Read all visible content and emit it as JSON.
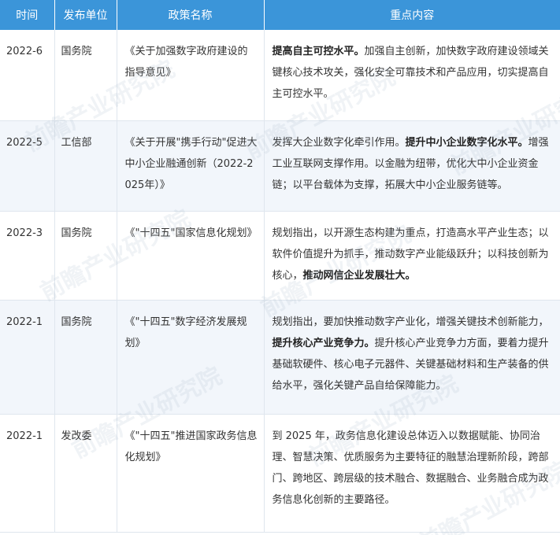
{
  "headers": [
    "时间",
    "发布单位",
    "政策名称",
    "重点内容"
  ],
  "rows": [
    {
      "time": "2022-6",
      "org": "国务院",
      "name": "《关于加强数字政府建设的指导意见》",
      "content": [
        {
          "bold": true,
          "text": "提高自主可控水平。"
        },
        {
          "bold": false,
          "text": "加强自主创新，加快数字政府建设领域关键核心技术攻关，强化安全可靠技术和产品应用，切实提高自主可控水平。"
        }
      ]
    },
    {
      "time": "2022-5",
      "org": "工信部",
      "name": "《关于开展\"携手行动\"促进大中小企业融通创新（2022-2025年）》",
      "content": [
        {
          "bold": false,
          "text": "发挥大企业数字化牵引作用。"
        },
        {
          "bold": true,
          "text": "提升中小企业数字化水平。"
        },
        {
          "bold": false,
          "text": "增强工业互联网支撑作用。以金融为纽带，优化大中小企业资金链；以平台载体为支撑，拓展大中小企业服务链等。"
        }
      ]
    },
    {
      "time": "2022-3",
      "org": "国务院",
      "name": "《\"十四五\"国家信息化规划》",
      "content": [
        {
          "bold": false,
          "text": "规划指出，以开源生态构建为重点，打造高水平产业生态；以软件价值提升为抓手，推动数字产业能级跃升；以科技创新为核心，"
        },
        {
          "bold": true,
          "text": "推动网信企业发展壮大。"
        }
      ]
    },
    {
      "time": "2022-1",
      "org": "国务院",
      "name": "《\"十四五\"数字经济发展规划》",
      "content": [
        {
          "bold": false,
          "text": "规划指出，要加快推动数字产业化，增强关键技术创新能力，"
        },
        {
          "bold": true,
          "text": "提升核心产业竞争力。"
        },
        {
          "bold": false,
          "text": "提升核心产业竞争力方面，要着力提升基础软硬件、核心电子元器件、关键基础材料和生产装备的供给水平，强化关键产品自给保障能力。"
        }
      ]
    },
    {
      "time": "2022-1",
      "org": "发改委",
      "name": "《\"十四五\"推进国家政务信息化规划》",
      "content": [
        {
          "bold": false,
          "text": "到 2025 年，政务信息化建设总体迈入以数据赋能、协同治理、智慧决策、优质服务为主要特征的融慧治理新阶段，跨部门、跨地区、跨层级的技术融合、数据融合、业务融合成为政务信息化创新的主要路径。"
        }
      ]
    }
  ],
  "watermark": "前瞻产业研究院"
}
